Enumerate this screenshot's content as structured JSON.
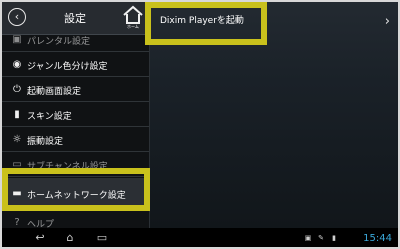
{
  "header": {
    "title": "設定",
    "back_icon": "back-arrow-icon",
    "home_label": "ホーム"
  },
  "sidebar": {
    "items": [
      {
        "label": "パレンタル設定",
        "icon": "lock-icon"
      },
      {
        "label": "ジャンル色分け設定",
        "icon": "radio-icon"
      },
      {
        "label": "起動画面設定",
        "icon": "power-icon"
      },
      {
        "label": "スキン設定",
        "icon": "phone-icon"
      },
      {
        "label": "振動設定",
        "icon": "vibrate-icon"
      },
      {
        "label": "サブチャンネル設定",
        "icon": "tv-icon"
      },
      {
        "label": "ホームネットワーク設定",
        "icon": "router-icon"
      },
      {
        "label": "ヘルプ",
        "icon": "help-icon"
      }
    ]
  },
  "main": {
    "items": [
      {
        "label": "Dixim Playerを起動",
        "icon": "chevron-right-icon"
      }
    ]
  },
  "statusbar": {
    "time": "15:44"
  },
  "colors": {
    "highlight": "#c9c11c",
    "clock": "#3aa7d8"
  }
}
